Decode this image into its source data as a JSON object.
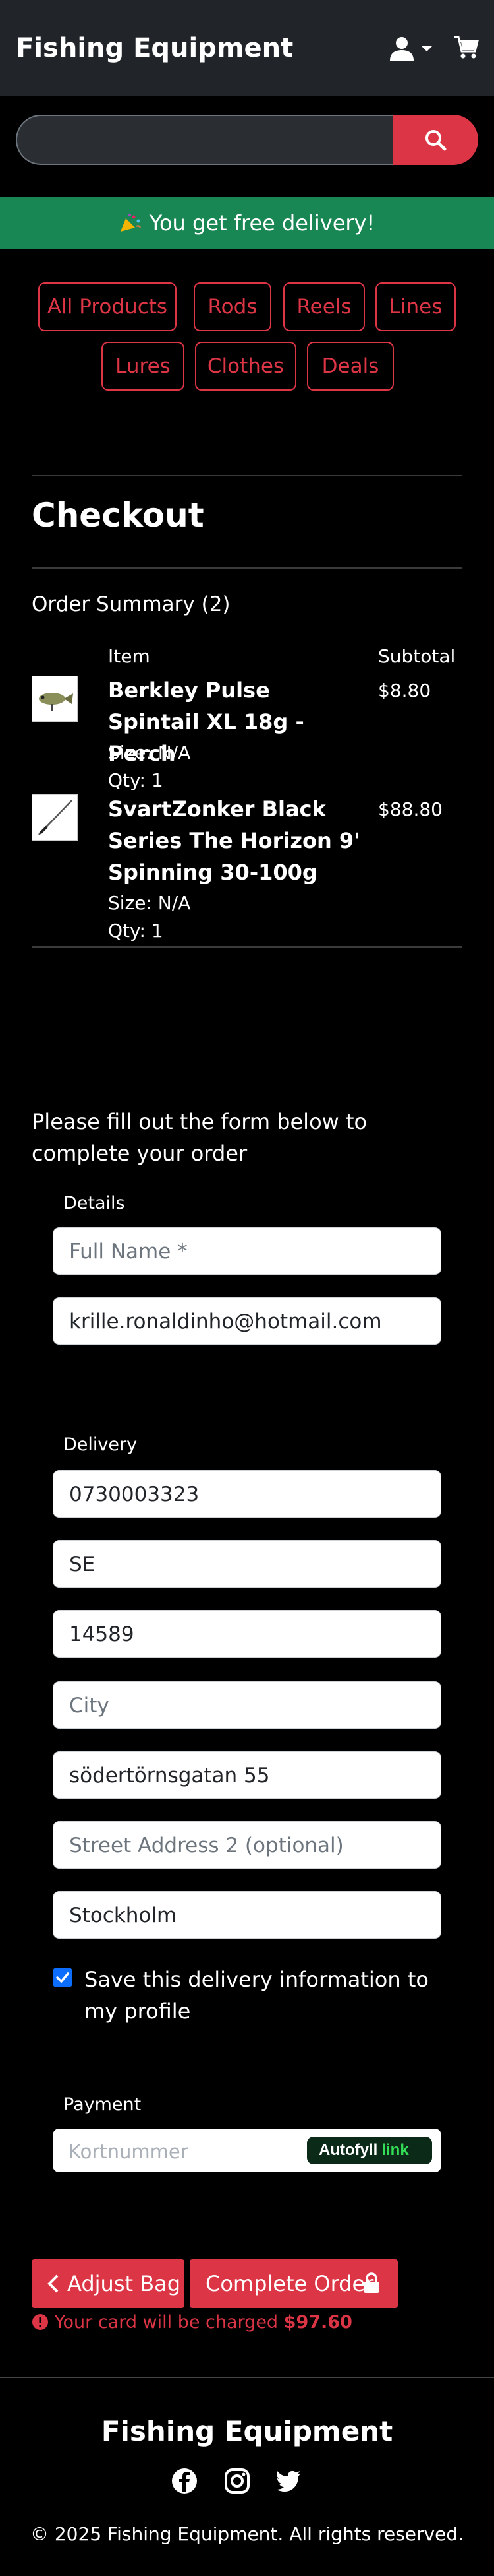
{
  "header": {
    "brand": "Fishing Equipment"
  },
  "search": {
    "value": ""
  },
  "banner": {
    "text": "You get free delivery!"
  },
  "categories": [
    "All Products",
    "Rods",
    "Reels",
    "Lines",
    "Lures",
    "Clothes",
    "Deals"
  ],
  "checkout": {
    "title": "Checkout",
    "summary_heading": "Order Summary (2)",
    "col_item": "Item",
    "col_subtotal": "Subtotal",
    "items": [
      {
        "name": "Berkley Pulse Spintail XL 18g - Perch",
        "size": "Size: N/A",
        "qty": "Qty: 1",
        "price": "$8.80"
      },
      {
        "name": "SvartZonker Black Series The Horizon 9' Spinning 30-100g",
        "size": "Size: N/A",
        "qty": "Qty: 1",
        "price": "$88.80"
      }
    ]
  },
  "form": {
    "intro": "Please fill out the form below to complete your order",
    "details_label": "Details",
    "full_name_placeholder": "Full Name *",
    "email": "krille.ronaldinho@hotmail.com",
    "delivery_label": "Delivery",
    "phone": "0730003323",
    "country": "SE",
    "postcode": "14589",
    "city_placeholder": "City",
    "street1": "södertörnsgatan 55",
    "street2_placeholder": "Street Address 2 (optional)",
    "county": "Stockholm",
    "save_info_label": "Save this delivery information to my profile",
    "save_info_checked": true,
    "payment_label": "Payment",
    "card_placeholder": "Kortnummer",
    "autofill_text": "Autofyll",
    "autofill_link": "link"
  },
  "actions": {
    "adjust_bag": "Adjust Bag",
    "complete_order": "Complete Order",
    "charge_prefix": "Your card will be charged",
    "charge_amount": "$97.60"
  },
  "footer": {
    "brand": "Fishing Equipment",
    "copyright": "© 2025 Fishing Equipment. All rights reserved."
  },
  "colors": {
    "accent": "#dc3545",
    "banner": "#198754",
    "navbar": "#212529",
    "checkbox": "#0d6efd"
  }
}
